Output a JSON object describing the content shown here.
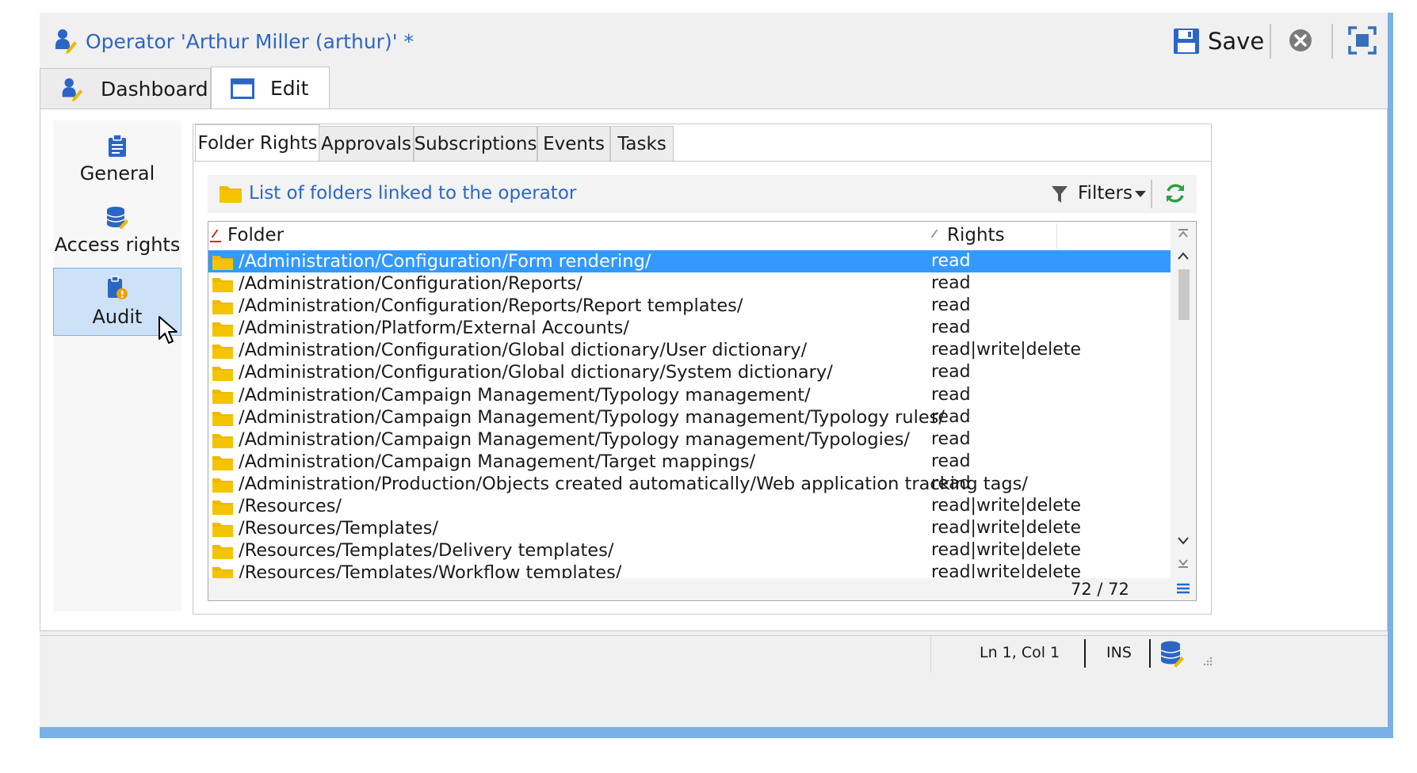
{
  "window": {
    "title": "Operator 'Arthur Miller (arthur)' *",
    "save_label": "Save"
  },
  "top_tabs": [
    {
      "label": "Dashboard",
      "icon": "operator-icon"
    },
    {
      "label": "Edit",
      "icon": "window-icon"
    }
  ],
  "side_nav": [
    {
      "label": "General",
      "icon": "clipboard-icon"
    },
    {
      "label": "Access rights",
      "icon": "database-key-icon"
    },
    {
      "label": "Audit",
      "icon": "audit-icon"
    }
  ],
  "sub_tabs": [
    "Folder Rights",
    "Approvals",
    "Subscriptions",
    "Events",
    "Tasks"
  ],
  "list": {
    "title": "List of folders linked to the operator",
    "filters_label": "Filters",
    "columns": {
      "folder": "Folder",
      "rights": "Rights"
    },
    "rows": [
      {
        "folder": "/Administration/Configuration/Form rendering/",
        "rights": "read"
      },
      {
        "folder": "/Administration/Configuration/Reports/",
        "rights": "read"
      },
      {
        "folder": "/Administration/Configuration/Reports/Report templates/",
        "rights": "read"
      },
      {
        "folder": "/Administration/Platform/External Accounts/",
        "rights": "read"
      },
      {
        "folder": "/Administration/Configuration/Global dictionary/User dictionary/",
        "rights": "read|write|delete"
      },
      {
        "folder": "/Administration/Configuration/Global dictionary/System dictionary/",
        "rights": "read"
      },
      {
        "folder": "/Administration/Campaign Management/Typology management/",
        "rights": "read"
      },
      {
        "folder": "/Administration/Campaign Management/Typology management/Typology rules/",
        "rights": "read"
      },
      {
        "folder": "/Administration/Campaign Management/Typology management/Typologies/",
        "rights": "read"
      },
      {
        "folder": "/Administration/Campaign Management/Target mappings/",
        "rights": "read"
      },
      {
        "folder": "/Administration/Production/Objects created automatically/Web application tracking tags/",
        "rights": "read"
      },
      {
        "folder": "/Resources/",
        "rights": "read|write|delete"
      },
      {
        "folder": "/Resources/Templates/",
        "rights": "read|write|delete"
      },
      {
        "folder": "/Resources/Templates/Delivery templates/",
        "rights": "read|write|delete"
      },
      {
        "folder": "/Resources/Templates/Workflow templates/",
        "rights": "read|write|delete"
      }
    ],
    "count": "72 / 72"
  },
  "status": {
    "position": "Ln 1, Col 1",
    "mode": "INS"
  },
  "colors": {
    "accent": "#2b66c6",
    "selection": "#3399ff",
    "folder": "#f0b800",
    "frame": "#7ab0e6"
  }
}
